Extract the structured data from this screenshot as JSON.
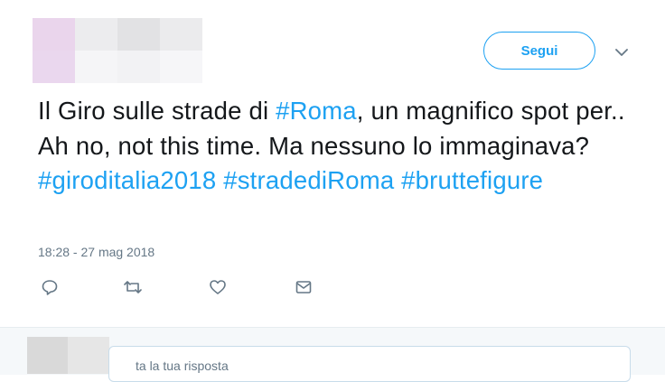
{
  "header": {
    "follow_label": "Segui",
    "caret_icon": "chevron-down-icon"
  },
  "tweet": {
    "segments": [
      {
        "text": "Il Giro sulle strade di ",
        "type": "text"
      },
      {
        "text": "#Roma",
        "type": "hashtag"
      },
      {
        "text": ", un magnifico spot per.. Ah no, not this time. Ma nessuno lo immaginava?",
        "type": "text"
      },
      {
        "text": "#giroditalia2018",
        "type": "hashtag"
      },
      {
        "text": " ",
        "type": "text"
      },
      {
        "text": "#stradediRoma",
        "type": "hashtag"
      },
      {
        "text": " ",
        "type": "text"
      },
      {
        "text": "#bruttefigure",
        "type": "hashtag"
      }
    ],
    "timestamp": "18:28 - 27 mag 2018"
  },
  "actions": [
    {
      "icon": "reply-icon"
    },
    {
      "icon": "retweet-icon"
    },
    {
      "icon": "like-icon"
    },
    {
      "icon": "direct-message-icon"
    }
  ],
  "reply": {
    "placeholder_visible": "ta la tua risposta"
  },
  "colors": {
    "accent": "#1da1f2",
    "text": "#14171a",
    "muted": "#657786"
  }
}
